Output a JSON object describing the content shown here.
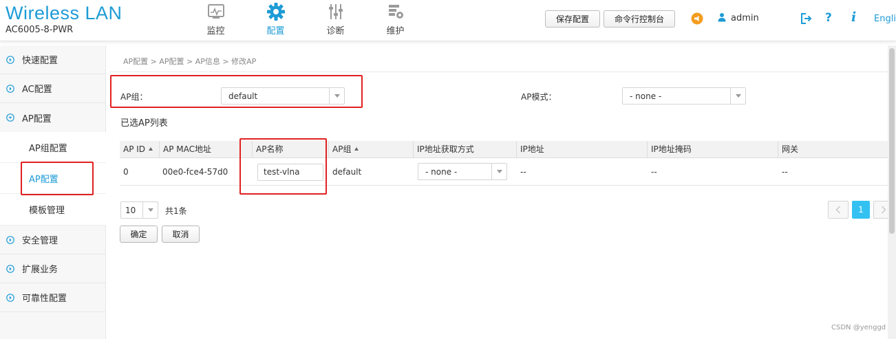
{
  "header": {
    "brand_title": "Wireless  LAN",
    "brand_model": "AC6005-8-PWR",
    "nav": [
      {
        "label": "监控",
        "icon": "monitor-icon"
      },
      {
        "label": "配置",
        "icon": "gear-icon",
        "active": true
      },
      {
        "label": "诊断",
        "icon": "sliders-icon"
      },
      {
        "label": "维护",
        "icon": "maintenance-icon"
      }
    ],
    "save_button": "保存配置",
    "cli_button": "命令行控制台",
    "user": "admin",
    "help": "?",
    "info": "i",
    "language": "English"
  },
  "sidebar": {
    "items": [
      {
        "label": "快速配置"
      },
      {
        "label": "AC配置"
      },
      {
        "label": "AP配置",
        "expanded": true
      },
      {
        "label": "安全管理"
      },
      {
        "label": "扩展业务"
      },
      {
        "label": "可靠性配置"
      }
    ],
    "sub_items": [
      {
        "label": "AP组配置"
      },
      {
        "label": "AP配置",
        "active": true
      },
      {
        "label": "模板管理"
      }
    ]
  },
  "main": {
    "breadcrumb": "AP配置 > AP配置 > AP信息 > 修改AP",
    "ap_group_label": "AP组：",
    "ap_group_value": "default",
    "ap_mode_label": "AP模式：",
    "ap_mode_value": "- none -",
    "section_title": "已选AP列表",
    "table": {
      "columns": [
        "AP ID",
        "AP MAC地址",
        "AP名称",
        "AP组",
        "IP地址获取方式",
        "IP地址",
        "IP地址掩码",
        "网关"
      ],
      "rows": [
        {
          "ap_id": "0",
          "mac": "00e0-fce4-57d0",
          "name": "test-vlna",
          "group": "default",
          "ip_method": "- none -",
          "ip": "--",
          "mask": "--",
          "gateway": "--"
        }
      ]
    },
    "page_size": "10",
    "total": "共1条",
    "current_page": "1",
    "ok_button": "确定",
    "cancel_button": "取消"
  },
  "watermark": "CSDN @yenggd",
  "colors": {
    "accent": "#1d9bd6",
    "pager_active": "#33c1f2",
    "highlight_box": "#e02020",
    "notice": "#f39c1f"
  }
}
